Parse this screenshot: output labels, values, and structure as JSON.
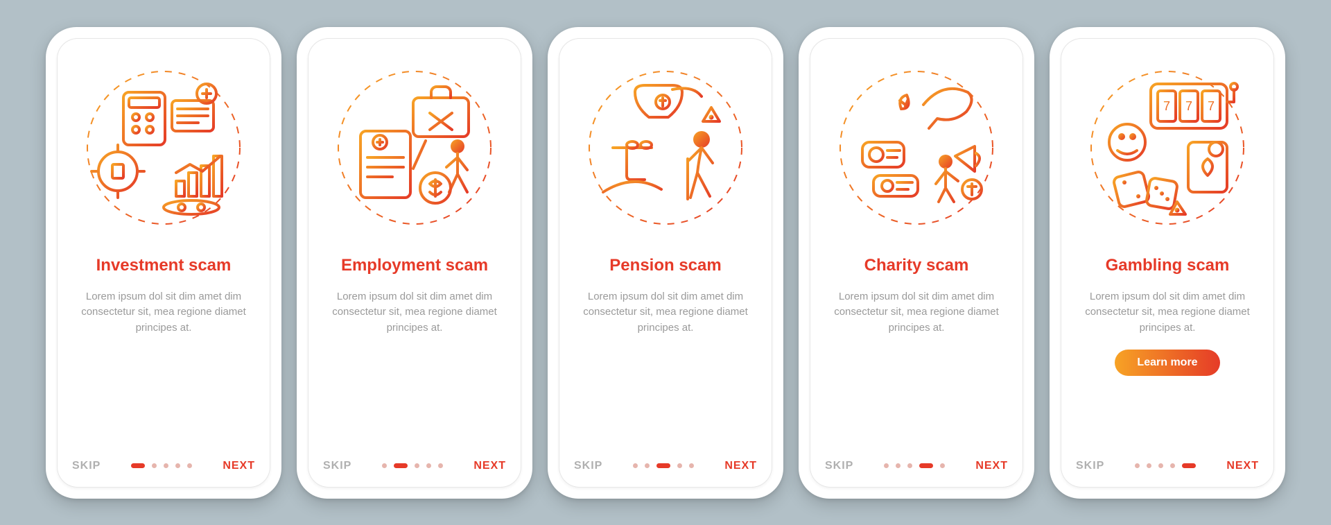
{
  "common": {
    "skip": "SKIP",
    "next": "NEXT",
    "description": "Lorem ipsum dol sit dim amet dim consectetur sit, mea regione diamet principes at.",
    "learn_more": "Learn more",
    "total_pages": 5
  },
  "screens": [
    {
      "title": "Investment scam",
      "icon": "investment-scam-icon",
      "active_dot": 0,
      "has_cta": false
    },
    {
      "title": "Employment scam",
      "icon": "employment-scam-icon",
      "active_dot": 1,
      "has_cta": false
    },
    {
      "title": "Pension scam",
      "icon": "pension-scam-icon",
      "active_dot": 2,
      "has_cta": false
    },
    {
      "title": "Charity scam",
      "icon": "charity-scam-icon",
      "active_dot": 3,
      "has_cta": false
    },
    {
      "title": "Gambling scam",
      "icon": "gambling-scam-icon",
      "active_dot": 4,
      "has_cta": true
    }
  ],
  "colors": {
    "background": "#b2c0c7",
    "accent_red": "#e63a28",
    "accent_orange": "#f7a325",
    "text_muted": "#9a9a9a"
  }
}
